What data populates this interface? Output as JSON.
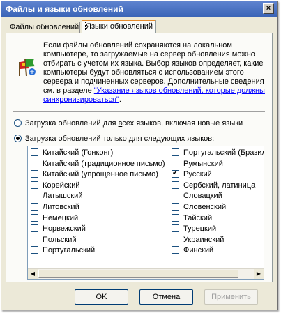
{
  "window": {
    "title": "Файлы и языки обновлений",
    "close_glyph": "×"
  },
  "tabs": [
    {
      "label": "Файлы обновлений"
    },
    {
      "label": "Языки обновлений"
    }
  ],
  "info": {
    "text": "Если файлы обновлений сохраняются на локальном компьютере, то загружаемые на сервер обновления можно отбирать с учетом их языка. Выбор языков определяет, какие компьютеры будут обновляться с использованием этого сервера и подчиненных серверов. Дополнительные сведения см. в разделе ",
    "link": "\"Указание языков обновлений, которые должны синхронизироваться\"",
    "suffix": "."
  },
  "options": {
    "all_languages": {
      "label_pre": "Загрузка обновлений для ",
      "label_ul": "в",
      "label_post": "сех языков, включая новые языки",
      "selected": false
    },
    "only_languages": {
      "label_pre": "Загрузка обновлений ",
      "label_ul": "т",
      "label_post": "олько для следующих языков:",
      "selected": true
    }
  },
  "languages_col1": [
    {
      "label": "Китайский (Гонконг)",
      "checked": false
    },
    {
      "label": "Китайский (традиционное письмо)",
      "checked": false
    },
    {
      "label": "Китайский (упрощенное письмо)",
      "checked": false
    },
    {
      "label": "Корейский",
      "checked": false
    },
    {
      "label": "Латышский",
      "checked": false
    },
    {
      "label": "Литовский",
      "checked": false
    },
    {
      "label": "Немецкий",
      "checked": false
    },
    {
      "label": "Норвежский",
      "checked": false
    },
    {
      "label": "Польский",
      "checked": false
    },
    {
      "label": "Португальский",
      "checked": false
    }
  ],
  "languages_col2": [
    {
      "label": "Португальский (Бразилия)",
      "checked": false
    },
    {
      "label": "Румынский",
      "checked": false
    },
    {
      "label": "Русский",
      "checked": true
    },
    {
      "label": "Сербский, латиница",
      "checked": false
    },
    {
      "label": "Словацкий",
      "checked": false
    },
    {
      "label": "Словенский",
      "checked": false
    },
    {
      "label": "Тайский",
      "checked": false
    },
    {
      "label": "Турецкий",
      "checked": false
    },
    {
      "label": "Украинский",
      "checked": false
    },
    {
      "label": "Финский",
      "checked": false
    }
  ],
  "buttons": {
    "ok": "OK",
    "cancel": "Отмена",
    "apply_pre": "",
    "apply_ul": "П",
    "apply_post": "рименить"
  }
}
